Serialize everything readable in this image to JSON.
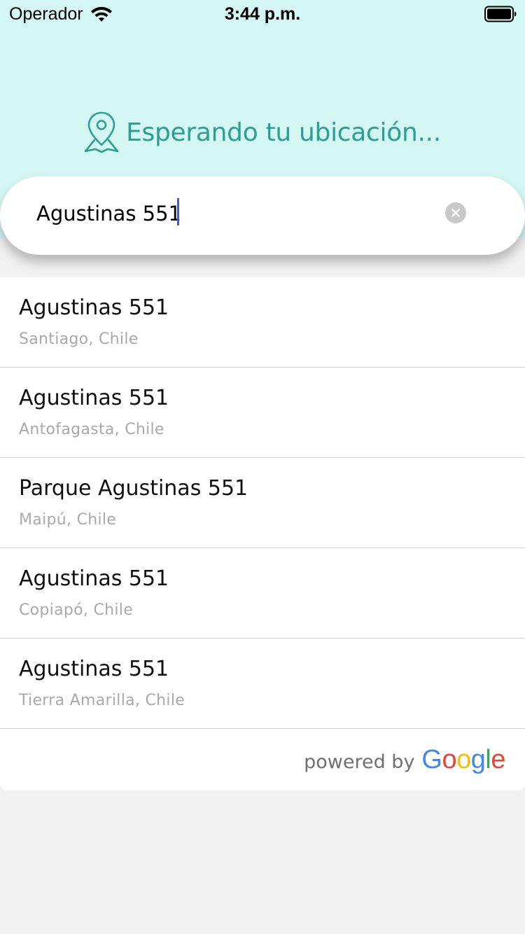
{
  "status_bar": {
    "carrier": "Operador",
    "time": "3:44 p.m.",
    "wifi_icon": "wifi-icon",
    "battery_icon": "battery-full-icon"
  },
  "header": {
    "location_text": "Esperando tu ubicación...",
    "icon": "map-pin-icon",
    "background_color": "#d4f7f3",
    "accent_color": "#2aa092"
  },
  "search": {
    "value": "Agustinas 551",
    "clear_icon": "clear-icon"
  },
  "results": [
    {
      "title": "Agustinas 551",
      "subtitle": "Santiago, Chile"
    },
    {
      "title": "Agustinas 551",
      "subtitle": "Antofagasta, Chile"
    },
    {
      "title": "Parque Agustinas 551",
      "subtitle": "Maipú, Chile"
    },
    {
      "title": "Agustinas 551",
      "subtitle": "Copiapó, Chile"
    },
    {
      "title": "Agustinas 551",
      "subtitle": "Tierra Amarilla, Chile"
    }
  ],
  "footer": {
    "powered_by": "powered by",
    "google_logo": "Google"
  }
}
